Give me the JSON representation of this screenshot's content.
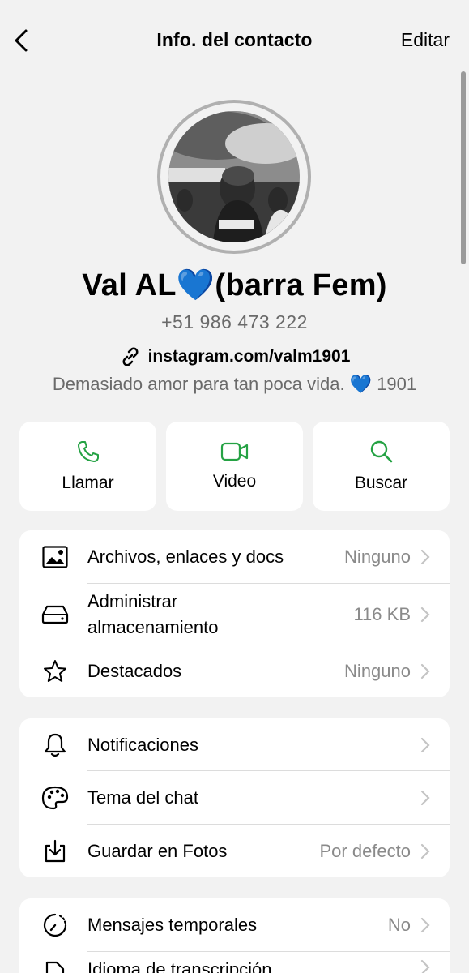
{
  "header": {
    "back_icon": "chevron-left-icon",
    "title": "Info. del contacto",
    "edit_label": "Editar"
  },
  "profile": {
    "avatar_icon": "profile-photo",
    "name": "Val AL💙(barra Fem)",
    "phone": "+51 986 473 222",
    "link_icon": "link-icon",
    "link": "instagram.com/valm1901",
    "about": "Demasiado amor para tan poca vida. 💙 1901"
  },
  "actions": [
    {
      "label": "Llamar",
      "icon": "phone-icon"
    },
    {
      "label": "Video",
      "icon": "video-camera-icon"
    },
    {
      "label": "Buscar",
      "icon": "search-icon"
    }
  ],
  "accent_color": "#25a244",
  "media_section": [
    {
      "label": "Archivos, enlaces y docs",
      "value": "Ninguno",
      "icon": "photo-icon"
    },
    {
      "label_line1": "Administrar",
      "label_line2": "almacenamiento",
      "value": "116 KB",
      "icon": "storage-drive-icon"
    },
    {
      "label": "Destacados",
      "value": "Ninguno",
      "icon": "star-icon"
    }
  ],
  "settings_section": [
    {
      "label": "Notificaciones",
      "value": "",
      "icon": "bell-icon"
    },
    {
      "label": "Tema del chat",
      "value": "",
      "icon": "palette-icon"
    },
    {
      "label": "Guardar en Fotos",
      "value": "Por defecto",
      "icon": "download-icon"
    }
  ],
  "privacy_section": [
    {
      "label": "Mensajes temporales",
      "value": "No",
      "icon": "timer-icon"
    },
    {
      "label": "Idioma de transcripción",
      "value": "",
      "icon": "transcription-icon"
    }
  ]
}
